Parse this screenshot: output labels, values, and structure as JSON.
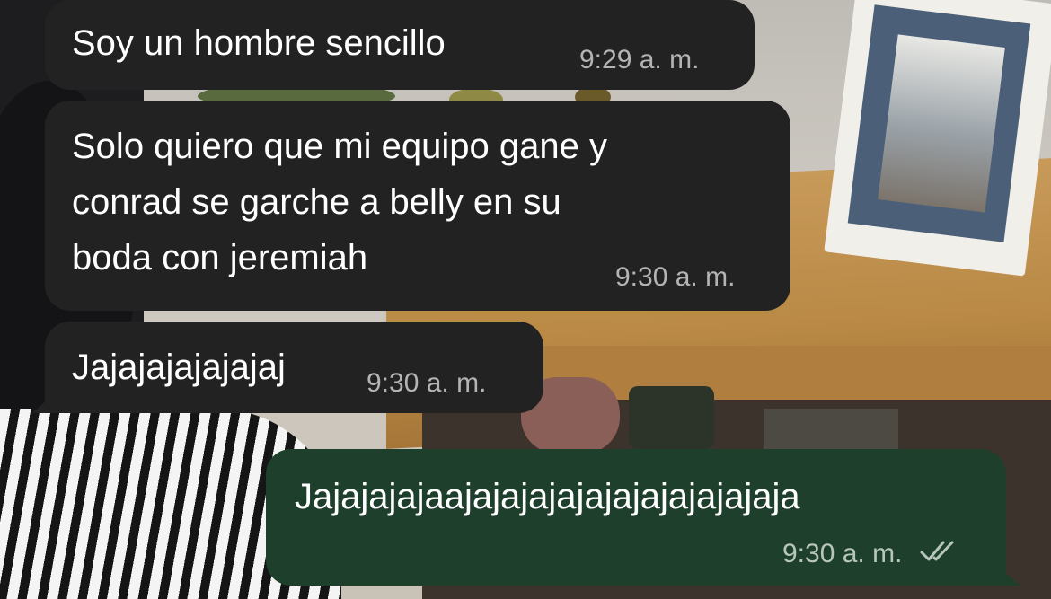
{
  "messages": [
    {
      "direction": "incoming",
      "text": "Soy un hombre sencillo",
      "time": "9:29 a. m."
    },
    {
      "direction": "incoming",
      "text": "Solo quiero que mi equipo gane y\nconrad se garche a belly en su\nboda con jeremiah",
      "time": "9:30 a. m."
    },
    {
      "direction": "incoming",
      "text": "Jajajajajajajaj",
      "time": "9:30 a. m."
    },
    {
      "direction": "outgoing",
      "text": "Jajajajajaajajajajajajajajajajajaja",
      "time": "9:30 a. m.",
      "status_icon": "double-check-icon"
    }
  ],
  "colors": {
    "incoming_bubble": "#222222",
    "outgoing_bubble": "#1e3f2c",
    "timestamp_text": "#b4b4b4"
  }
}
